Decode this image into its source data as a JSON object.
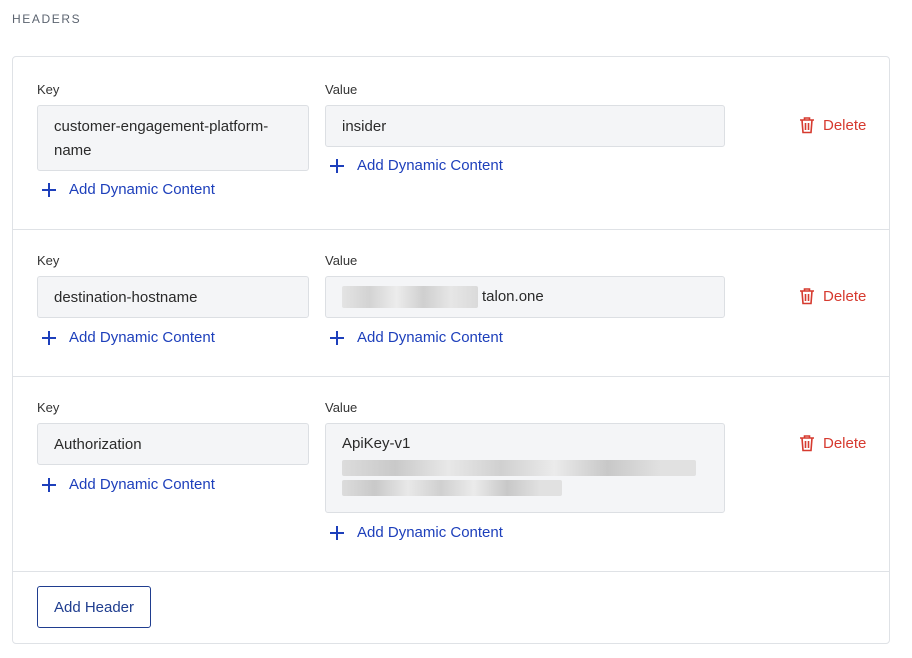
{
  "section": {
    "title": "HEADERS"
  },
  "headers": [
    {
      "key_label": "Key",
      "key_value": "customer-engagement-platform-name",
      "value_label": "Value",
      "value_value": "insider",
      "add_dynamic_key": "Add Dynamic Content",
      "add_dynamic_value": "Add Dynamic Content",
      "delete_label": "Delete"
    },
    {
      "key_label": "Key",
      "key_value": "destination-hostname",
      "value_label": "Value",
      "value_suffix": "talon.one",
      "add_dynamic_key": "Add Dynamic Content",
      "add_dynamic_value": "Add Dynamic Content",
      "delete_label": "Delete"
    },
    {
      "key_label": "Key",
      "key_value": "Authorization",
      "value_label": "Value",
      "value_prefix": "ApiKey-v1",
      "add_dynamic_key": "Add Dynamic Content",
      "add_dynamic_value": "Add Dynamic Content",
      "delete_label": "Delete"
    }
  ],
  "footer": {
    "add_header_label": "Add Header"
  },
  "icons": {
    "add": "plus-icon",
    "delete": "trash-icon"
  },
  "colors": {
    "link": "#1d3fbb",
    "danger": "#d63a2f",
    "button_border": "#1f3d8f"
  }
}
